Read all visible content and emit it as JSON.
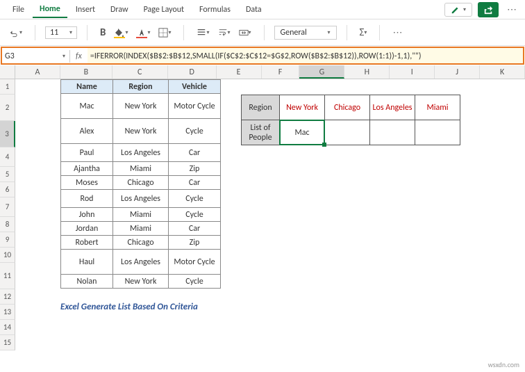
{
  "menu": {
    "items": [
      "File",
      "Home",
      "Insert",
      "Draw",
      "Page Layout",
      "Formulas",
      "Data"
    ],
    "active": 1
  },
  "toolbar": {
    "font_size": "11",
    "bold": "B",
    "number_format": "General"
  },
  "namebox": "G3",
  "formula": "=IFERROR(INDEX($B$2:$B$12,SMALL(IF($C$2:$C$12=$G$2,ROW($B$2:$B$12)),ROW(1:1))-1,1),\"\")",
  "cols": [
    "A",
    "B",
    "C",
    "D",
    "E",
    "F",
    "G",
    "H",
    "I",
    "J",
    "K"
  ],
  "table1": {
    "headers": [
      "Name",
      "Region",
      "Vehicle"
    ],
    "rows": [
      [
        "Mac",
        "New York",
        "Motor Cycle"
      ],
      [
        "Alex",
        "New York",
        "Cycle"
      ],
      [
        "Paul",
        "Los Angeles",
        "Car"
      ],
      [
        "Ajantha",
        "Miami",
        "Zip"
      ],
      [
        "Moses",
        "Chicago",
        "Car"
      ],
      [
        "Rod",
        "Los Angeles",
        "Cycle"
      ],
      [
        "John",
        "Miami",
        "Cycle"
      ],
      [
        "Jordan",
        "Miami",
        "Car"
      ],
      [
        "Robert",
        "Chicago",
        "Zip"
      ],
      [
        "Haul",
        "Los Angeles",
        "Motor Cycle"
      ],
      [
        "Nolan",
        "New York",
        "Cycle"
      ]
    ]
  },
  "table2": {
    "r1": [
      "Region",
      "New York",
      "Chicago",
      "Los Angeles",
      "Miami"
    ],
    "r2": [
      "List of People",
      "Mac",
      "",
      "",
      ""
    ]
  },
  "caption": "Excel Generate List Based On Criteria",
  "watermark": "wsxdn.com",
  "chart_data": {
    "type": "table",
    "title": "Excel Generate List Based On Criteria",
    "source_table": {
      "columns": [
        "Name",
        "Region",
        "Vehicle"
      ],
      "rows": [
        [
          "Mac",
          "New York",
          "Motor Cycle"
        ],
        [
          "Alex",
          "New York",
          "Cycle"
        ],
        [
          "Paul",
          "Los Angeles",
          "Car"
        ],
        [
          "Ajantha",
          "Miami",
          "Zip"
        ],
        [
          "Moses",
          "Chicago",
          "Car"
        ],
        [
          "Rod",
          "Los Angeles",
          "Cycle"
        ],
        [
          "John",
          "Miami",
          "Cycle"
        ],
        [
          "Jordan",
          "Miami",
          "Car"
        ],
        [
          "Robert",
          "Chicago",
          "Zip"
        ],
        [
          "Haul",
          "Los Angeles",
          "Motor Cycle"
        ],
        [
          "Nolan",
          "New York",
          "Cycle"
        ]
      ]
    },
    "result_table": {
      "Region": [
        "New York",
        "Chicago",
        "Los Angeles",
        "Miami"
      ],
      "List of People": [
        "Mac",
        "",
        "",
        ""
      ]
    },
    "formula": "=IFERROR(INDEX($B$2:$B$12,SMALL(IF($C$2:$C$12=$G$2,ROW($B$2:$B$12)),ROW(1:1))-1,1),\"\")",
    "active_cell": "G3"
  }
}
